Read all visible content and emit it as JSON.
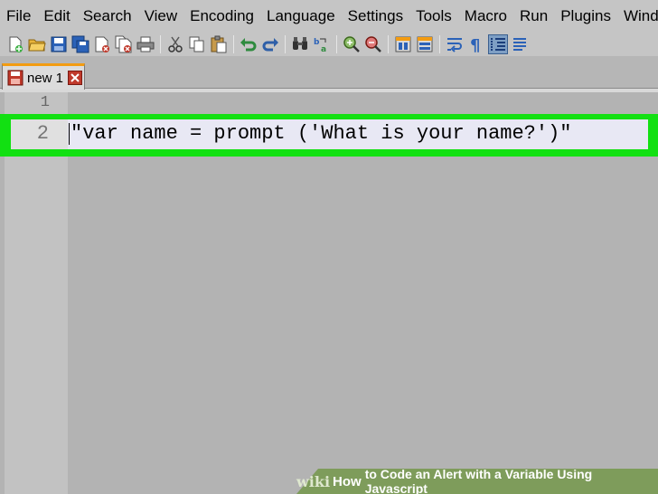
{
  "menu": [
    "File",
    "Edit",
    "Search",
    "View",
    "Encoding",
    "Language",
    "Settings",
    "Tools",
    "Macro",
    "Run",
    "Plugins",
    "Wind"
  ],
  "toolbar": {
    "icons": [
      "new-file-icon",
      "open-file-icon",
      "save-icon",
      "save-all-icon",
      "close-icon",
      "close-all-icon",
      "print-icon",
      "cut-icon",
      "copy-icon",
      "paste-icon",
      "undo-icon",
      "redo-icon",
      "find-icon",
      "replace-icon",
      "zoom-in-icon",
      "zoom-out-icon",
      "sync-vertical-icon",
      "sync-horizontal-icon",
      "word-wrap-icon",
      "show-all-characters-icon",
      "indent-guide-icon",
      "more-icon"
    ],
    "active": "indent-guide-icon"
  },
  "tab": {
    "label": "new 1"
  },
  "editor": {
    "lines": [
      {
        "number": "1",
        "text": ""
      },
      {
        "number": "2",
        "text": "\"var name = prompt ('What is your name?')\""
      }
    ]
  },
  "watermark": {
    "wiki": "wiki",
    "how": "How",
    "text": "to Code an Alert with a Variable Using Javascript"
  },
  "colors": {
    "highlight": "#12e012",
    "tab_accent": "#f39c12",
    "close_red": "#c0392b",
    "banner": "#7e9c5b"
  }
}
